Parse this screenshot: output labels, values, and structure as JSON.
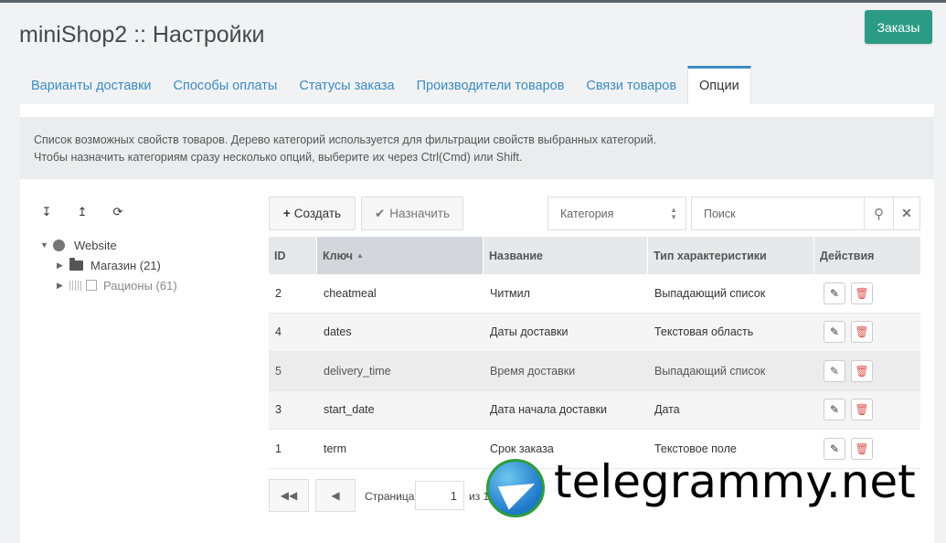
{
  "header": {
    "title": "miniShop2 :: Настройки",
    "orders_button": "Заказы"
  },
  "tabs": [
    {
      "label": "Варианты доставки"
    },
    {
      "label": "Способы оплаты"
    },
    {
      "label": "Статусы заказа"
    },
    {
      "label": "Производители товаров"
    },
    {
      "label": "Связи товаров"
    },
    {
      "label": "Опции",
      "active": true
    }
  ],
  "description": {
    "line1": "Список возможных свойств товаров. Дерево категорий используется для фильтрации свойств выбранных категорий.",
    "line2": "Чтобы назначить категориям сразу несколько опций, выберите их через Ctrl(Cmd) или Shift."
  },
  "tree": {
    "root": "Website",
    "children": [
      {
        "label": "Магазин (21)"
      },
      {
        "label": "Рационы (61)"
      }
    ]
  },
  "toolbar": {
    "create_label": "Создать",
    "assign_label": "Назначить",
    "category_placeholder": "Категория",
    "search_placeholder": "Поиск"
  },
  "grid": {
    "columns": [
      "ID",
      "Ключ",
      "Название",
      "Тип характеристики",
      "Действия"
    ],
    "rows": [
      {
        "id": "2",
        "key": "cheatmeal",
        "name": "Читмил",
        "type": "Выпадающий список"
      },
      {
        "id": "4",
        "key": "dates",
        "name": "Даты доставки",
        "type": "Текстовая область"
      },
      {
        "id": "5",
        "key": "delivery_time",
        "name": "Время доставки",
        "type": "Выпадающий список"
      },
      {
        "id": "3",
        "key": "start_date",
        "name": "Дата начала доставки",
        "type": "Дата"
      },
      {
        "id": "1",
        "key": "term",
        "name": "Срок заказа",
        "type": "Текстовое поле"
      }
    ]
  },
  "pager": {
    "page_label": "Страница",
    "page_value": "1",
    "of_label": "из 1"
  },
  "watermark": {
    "text": "telegrammy.net"
  },
  "colors": {
    "accent": "#3c8bc0",
    "orders_button": "#2c9b86",
    "delete": "#d9534f"
  }
}
